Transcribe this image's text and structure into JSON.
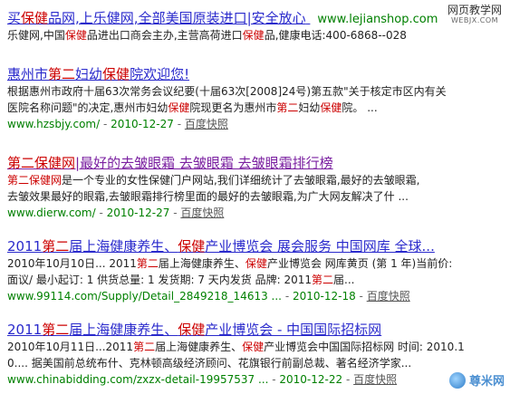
{
  "watermark_top": {
    "line1": "网页教学网",
    "line2": "WEBJX.COM"
  },
  "watermark_bottom": {
    "text": "尊米网"
  },
  "results": [
    {
      "title_parts": [
        "买",
        "保健",
        "品网,上乐健网,全部美国原装进口|安全放心"
      ],
      "inline_url": "www.lejianshop.com",
      "snippet_lines": [
        [
          "乐健网,中国",
          "保健",
          "品进出口商会主办,主营高荷进口",
          "保健",
          "品,健康电话:400-6868--028"
        ]
      ]
    },
    {
      "title_parts": [
        "惠州市",
        "第二",
        "妇幼",
        "保健",
        "院欢迎您!"
      ],
      "snippet_lines": [
        [
          "根据惠州市政府十届63次常务会议纪要(十届63次[2008]24号)第五款\"关于核定市区内有关"
        ],
        [
          "医院名称问题\"的决定,惠州市妇幼",
          "保健",
          "院现更名为惠州市",
          "第二",
          "妇幼",
          "保健",
          "院。 ..."
        ]
      ],
      "url": "www.hzsbjy.com/",
      "date": "2010-12-27",
      "cache": "百度快照"
    },
    {
      "title_parts": [
        "第二保健网",
        "|最好的去皱眼霜 去皱眼霜 去皱眼霜排行榜"
      ],
      "snippet_lines": [
        [
          "第二保健网",
          "是一个专业的女性保健门户网站,我们详细统计了去皱眼霜,最好的去皱眼霜,"
        ],
        [
          "去皱效果最好的眼霜,去皱眼霜排行榜里面的最好的去皱眼霜,为广大网友解决了什 ..."
        ]
      ],
      "url": "www.dierw.com/",
      "date": "2010-12-27",
      "cache": "百度快照"
    },
    {
      "title_parts": [
        "2011",
        "第二",
        "届上海健康养生、",
        "保健",
        "产业博览会 展会服务 中国网库 全球..."
      ],
      "snippet_lines": [
        [
          "2010年10月10日... 2011",
          "第二",
          "届上海健康养生、",
          "保健",
          "产业博览会 网库黄页 (第 1 年)当前价:"
        ],
        [
          "面议/ 最小起订: 1 供货总量: 1 发货期: 7 天内发货 品牌: 2011",
          "第二",
          "届..."
        ]
      ],
      "url": "www.99114.com/Supply/Detail_2849218_14613 ...",
      "date": "2010-12-18",
      "cache": "百度快照"
    },
    {
      "title_parts": [
        "2011",
        "第二",
        "届上海健康养生、",
        "保健",
        "产业博览会 - 中国国际招标网"
      ],
      "snippet_lines": [
        [
          "2010年10月11日...2011",
          "第二",
          "届上海健康养生、",
          "保健",
          "产业博览会中国国际招标网 时间: 2010.1"
        ],
        [
          "0.... 据美国前总统布什、克林顿高级经济顾问、花旗银行前副总裁、著名经济学家..."
        ]
      ],
      "url": "www.chinabidding.com/zxzx-detail-19957537 ...",
      "date": "2010-12-22",
      "cache": "百度快照"
    }
  ]
}
